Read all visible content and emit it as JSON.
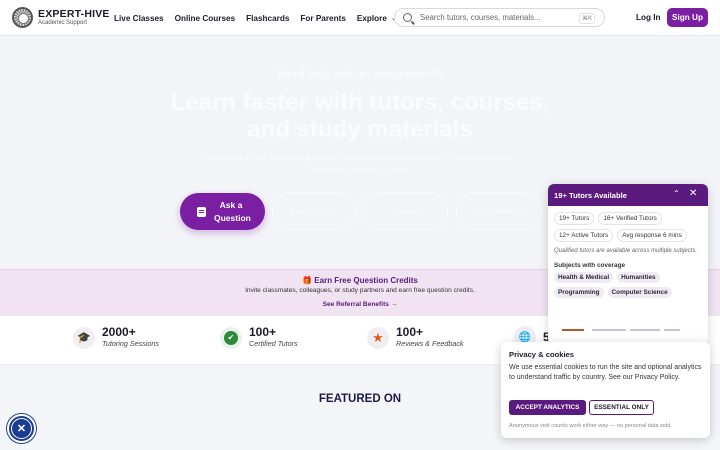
{
  "brand": {
    "name": "EXPERT-HIVE",
    "tagline": "Academic Support"
  },
  "nav": {
    "items": [
      "Live Classes",
      "Online Courses",
      "Flashcards",
      "For Parents",
      "Explore"
    ],
    "explore_chevron": "⌄"
  },
  "search": {
    "placeholder": "Search tutors, courses, materials...",
    "shortcut": "⌘K"
  },
  "auth": {
    "login": "Log In",
    "signup": "Sign Up"
  },
  "hero": {
    "eyebrow": "Need help with an assignment?",
    "title_line1": "Learn faster with tutors, courses,",
    "title_line2": "and study materials",
    "subtitle": "Assignment help, live tutoring, online courses, and study resources — matched to your academic support program.",
    "ask_button": "Ask a Question",
    "live_tutoring": "Live Tutoring",
    "browse": "Browse",
    "study_materials": "Study Materials"
  },
  "referral": {
    "icon": "🎁",
    "title": "Earn Free Question Credits",
    "text": "Invite classmates, colleagues, or study partners and earn free question credits.",
    "link": "See Referral Benefits →"
  },
  "stats": [
    {
      "icon": "graduation-cap",
      "glyph": "🎓",
      "value": "2000+",
      "label": "Tutoring Sessions"
    },
    {
      "icon": "verified-check",
      "glyph": "✔",
      "value": "100+",
      "label": "Certified Tutors"
    },
    {
      "icon": "star",
      "glyph": "★",
      "value": "100+",
      "label": "Reviews & Feedback"
    },
    {
      "icon": "globe",
      "glyph": "🌐",
      "value": "5",
      "label": ""
    }
  ],
  "featured": {
    "title": "FEATURED ON"
  },
  "tutors_panel": {
    "title": "19+ Tutors Available",
    "chips": [
      "19+ Tutors",
      "16+ Verified Tutors",
      "12+ Active Tutors",
      "Avg response 6 mins"
    ],
    "note": "Qualified tutors are available across multiple subjects.",
    "subjects_heading": "Subjects with coverage",
    "subjects": [
      "Health & Medical",
      "Humanities",
      "Programming",
      "Computer Science"
    ]
  },
  "cookie": {
    "title": "Privacy & cookies",
    "text": "We use essential cookies to run the site and optional analytics to understand traffic by country. See our Privacy Policy.",
    "accept": "ACCEPT ANALYTICS",
    "essential": "ESSENTIAL ONLY",
    "footer": "Anonymous visit counts work either way — no personal data sold."
  },
  "colors": {
    "brand_purple": "#7a1fa2",
    "dark_purple": "#5b1a7d",
    "accent_orange": "#e05a1e",
    "accessibility_blue": "#1a3d8f"
  }
}
